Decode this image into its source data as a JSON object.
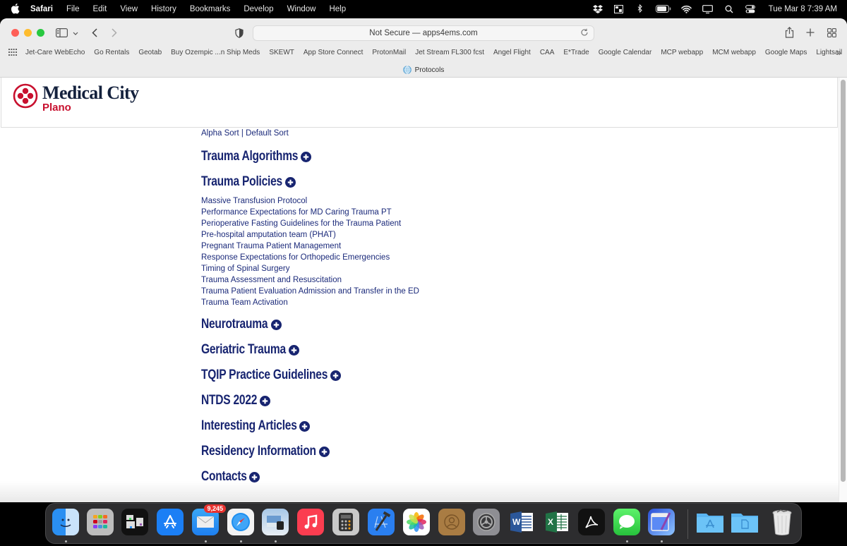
{
  "menubar": {
    "app_name": "Safari",
    "menus": [
      "File",
      "Edit",
      "View",
      "History",
      "Bookmarks",
      "Develop",
      "Window",
      "Help"
    ],
    "status_icons": [
      "dropbox-icon",
      "display-layout-icon",
      "bluetooth-icon",
      "battery-icon",
      "wifi-icon",
      "screen-mirroring-icon",
      "spotlight-search-icon",
      "control-center-icon"
    ],
    "clock": "Tue Mar 8  7:39 AM"
  },
  "browser": {
    "url_text": "Not Secure — apps4ems.com",
    "bookmarks": [
      "Jet-Care WebEcho",
      "Go Rentals",
      "Geotab",
      "Buy Ozempic ...n Ship Meds",
      "SKEWT",
      "App Store Connect",
      "ProtonMail",
      "Jet Stream FL300 fcst",
      "Angel Flight",
      "CAA",
      "E*Trade",
      "Google Calendar",
      "MCP webapp",
      "MCM webapp",
      "Google Maps",
      "Lightsail"
    ],
    "tab_title": "Protocols"
  },
  "site": {
    "logo_name": "Medical City",
    "logo_sub": "Plano",
    "brand_red": "#c8102e",
    "brand_navy": "#172470"
  },
  "content": {
    "sort": {
      "alpha": "Alpha Sort",
      "separator": " | ",
      "default": "Default Sort"
    },
    "sections": [
      {
        "title": "Trauma Algorithms",
        "items": []
      },
      {
        "title": "Trauma Policies",
        "items": [
          "Massive Transfusion Protocol",
          "Performance Expectations for MD Caring Trauma PT",
          "Perioperative Fasting Guidelines for the Trauma Patient",
          "Pre-hospital amputation team (PHAT)",
          "Pregnant Trauma Patient Management",
          "Response Expectations for Orthopedic Emergencies",
          "Timing of Spinal Surgery",
          "Trauma Assessment and Resuscitation",
          "Trauma Patient Evaluation Admission and Transfer in the ED",
          "Trauma Team Activation"
        ]
      },
      {
        "title": "Neurotrauma",
        "items": []
      },
      {
        "title": "Geriatric Trauma",
        "items": []
      },
      {
        "title": "TQIP Practice Guidelines",
        "items": []
      },
      {
        "title": "NTDS 2022",
        "items": []
      },
      {
        "title": "Interesting Articles",
        "items": []
      },
      {
        "title": "Residency Information",
        "items": []
      },
      {
        "title": "Contacts",
        "items": []
      }
    ]
  },
  "dock": {
    "apps": [
      "Finder",
      "Launchpad",
      "Mission Control",
      "App Store",
      "Mail",
      "Safari",
      "Preview",
      "Music",
      "Calculator",
      "Xcode",
      "Photos",
      "Contacts",
      "System Preferences",
      "Microsoft Word",
      "Microsoft Excel",
      "Adobe Acrobat",
      "Messages",
      "RapidWeaver"
    ],
    "folders": [
      "Applications",
      "Documents"
    ],
    "trash": "Trash",
    "mail_badge": "9,245"
  }
}
